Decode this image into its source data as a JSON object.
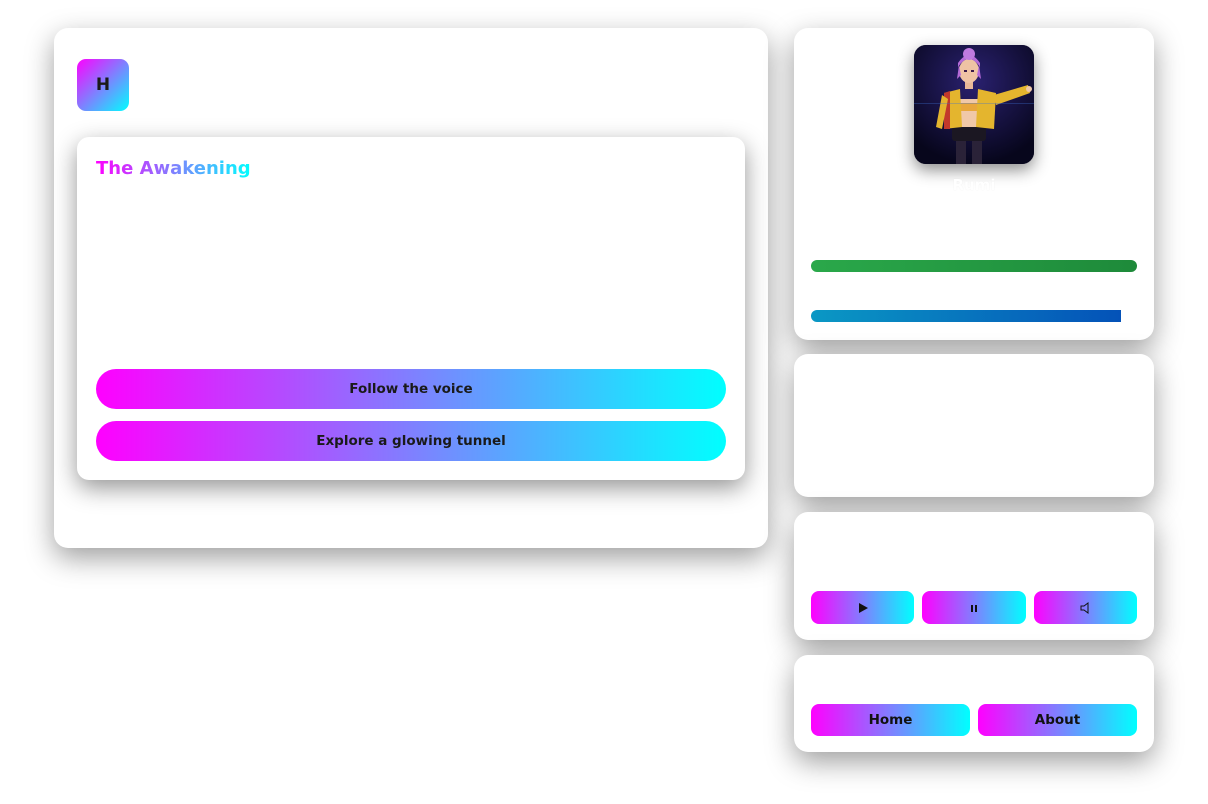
{
  "logo": {
    "letter": "H"
  },
  "story": {
    "title": "The Awakening",
    "choices": [
      {
        "label": "Follow the voice"
      },
      {
        "label": "Explore a glowing tunnel"
      }
    ]
  },
  "character": {
    "name": "Rumi",
    "health_fraction": 1.0,
    "energy_fraction": 0.95
  },
  "audio": {
    "play_icon": "play-icon",
    "pause_icon": "pause-icon",
    "volume_icon": "volume-icon",
    "play_glyph": "▶",
    "pause_glyph": "⏸",
    "volume_glyph": "🔈"
  },
  "nav": {
    "home_label": "Home",
    "about_label": "About"
  },
  "colors": {
    "gradient_start": "#ff00ff",
    "gradient_end": "#00ffff",
    "health": "#2aa84a",
    "energy": "#0452b8"
  }
}
